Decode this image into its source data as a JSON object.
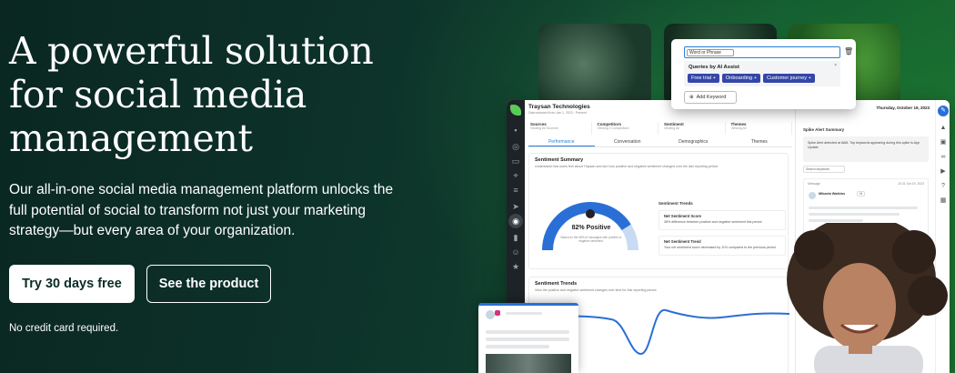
{
  "hero": {
    "headline": "A powerful solution for social media management",
    "subheadline": "Our all-in-one social media management platform unlocks the full potential of social to transform not just your marketing strategy—but every area of your organization.",
    "primary_cta": "Try 30 days free",
    "secondary_cta": "See the product",
    "note": "No credit card required."
  },
  "app": {
    "company": "Traysan Technologies",
    "company_sub": "Data selected from Jan 1, 2023 · Present",
    "filters": [
      {
        "label": "Sources",
        "value": "Viewing All Sources"
      },
      {
        "label": "Competitors",
        "value": "Viewing 3 Competitors"
      },
      {
        "label": "Sentiment",
        "value": "Viewing All"
      },
      {
        "label": "Themes",
        "value": "Viewing All"
      }
    ],
    "tabs": [
      "Performance",
      "Conversation",
      "Demographics",
      "Themes"
    ],
    "summary": {
      "title": "Sentiment Summary",
      "desc": "Understand how users feel about Traysan and see how positive and negative sentiment changed over the last reporting period.",
      "gauge_value": "82% Positive",
      "gauge_percent": 82,
      "gauge_caption": "Based on the 58% of messages with positive or negative sentiment.",
      "trends_title": "Sentiment Trends",
      "metrics": [
        {
          "title": "Net Sentiment Score",
          "desc": "38% difference between positive and negative sentiment this period."
        },
        {
          "title": "Net Sentiment Trend",
          "desc": "Your net sentiment score decreased by 11% compared to the previous period."
        }
      ]
    },
    "trends": {
      "title": "Sentiment Trends",
      "desc": "View the positive and negative sentiment changes over time for this reporting period."
    },
    "right_panel": {
      "date": "Thursday, October 19, 2023",
      "alert_title": "Spike Alert Summary",
      "alert_text": "Spike Alert detected at 8AM. Top keywords appearing during this spike is App Update",
      "select": "Search keywords",
      "msg_header": "Message",
      "msg_time": "10:31 Oct 19, 2023",
      "msg_name": "Mikaela Watkins",
      "msg_badge": "Hi"
    }
  },
  "popup": {
    "select": "Word or Phrase",
    "title": "Queries by AI Assist",
    "chips": [
      "Free trial +",
      "Onboarding +",
      "Customer journey +"
    ],
    "add_label": "Add Keyword"
  },
  "colors": {
    "bg_dark": "#0b2b25",
    "accent_blue": "#2a7fd6",
    "chip": "#3546a8",
    "gauge": "#2a6fd6",
    "brand_green": "#59cb59"
  }
}
